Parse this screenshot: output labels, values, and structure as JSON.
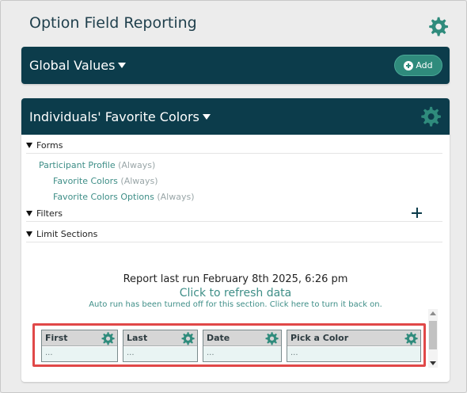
{
  "page": {
    "title": "Option Field Reporting",
    "settings_icon": "gear-icon"
  },
  "global_values": {
    "title": "Global Values",
    "add_label": "Add",
    "add_icon": "plus-circle-icon"
  },
  "section": {
    "title": "Individuals' Favorite Colors",
    "settings_icon": "gear-icon",
    "forms_label": "Forms",
    "forms": [
      {
        "name": "Participant Profile",
        "status": "(Always)"
      },
      {
        "name": "Favorite Colors",
        "status": "(Always)"
      },
      {
        "name": "Favorite Colors Options",
        "status": "(Always)"
      }
    ],
    "filters_label": "Filters",
    "limit_sections_label": "Limit Sections",
    "report_last_run": "Report last run February 8th 2025, 6:26 pm",
    "refresh_link": "Click to refresh data",
    "autorun_note": "Auto run has been turned off for this section. Click here to turn it back on.",
    "columns": [
      {
        "header": "First",
        "value": "..."
      },
      {
        "header": "Last",
        "value": "..."
      },
      {
        "header": "Date",
        "value": "..."
      },
      {
        "header": "Pick a Color",
        "value": "..."
      }
    ]
  },
  "colors": {
    "header_bg": "#0c3c4b",
    "accent": "#2f8b7c",
    "link": "#3e8e87",
    "highlight": "#e04848"
  }
}
